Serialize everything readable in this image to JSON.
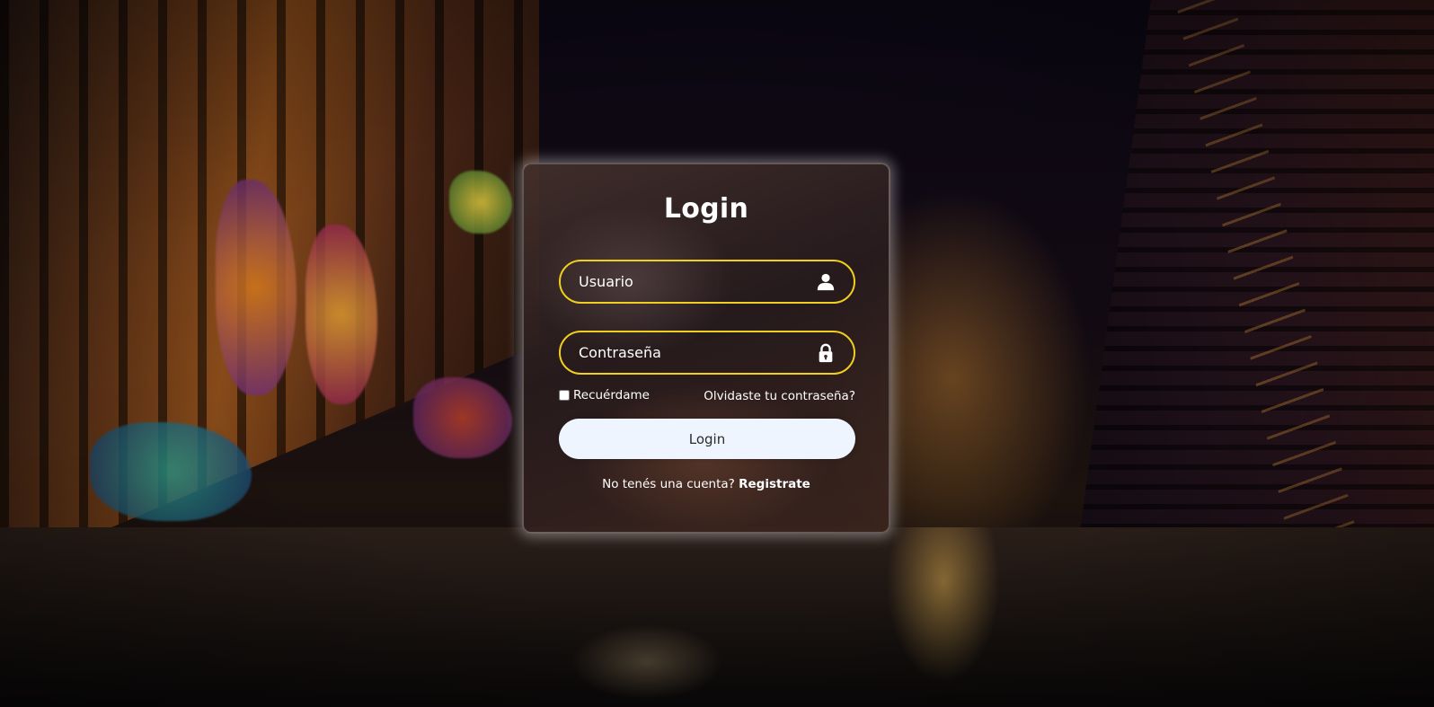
{
  "background": {
    "description_icon": "night-alley-photo"
  },
  "login": {
    "title": "Login",
    "username_placeholder": "Usuario",
    "username_icon": "user-icon",
    "password_placeholder": "Contraseña",
    "password_icon": "lock-icon",
    "remember_label": "Recuérdame",
    "remember_checked": false,
    "forgot_link": "Olvidaste tu contraseña?",
    "submit_label": "Login",
    "register_prompt": "No tenés una cuenta?",
    "register_link": "Registrate"
  },
  "colors": {
    "field_border": "#f0cf1e",
    "button_bg": "#eef5ff",
    "text": "#ffffff"
  }
}
